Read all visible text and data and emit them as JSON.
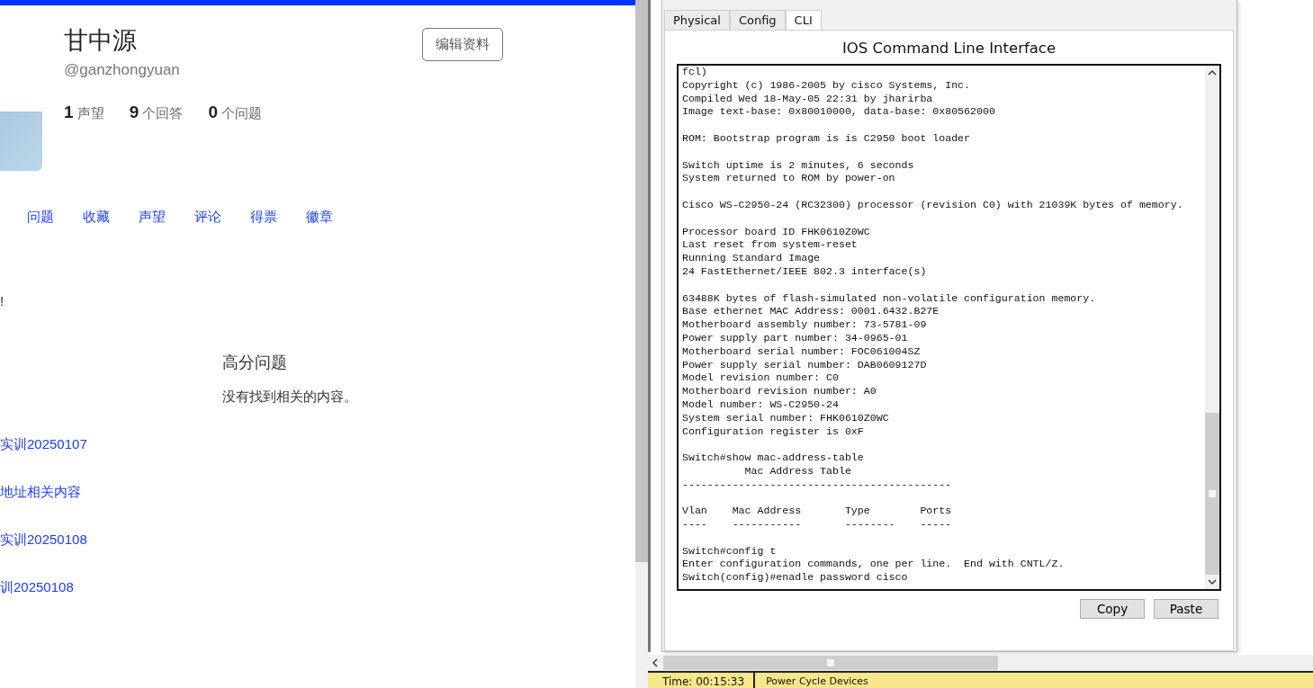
{
  "profile": {
    "name": "甘中源",
    "handle": "@ganzhongyuan",
    "edit_button": "编辑资料",
    "stats": [
      "**1** 声望",
      "**9** 个回答",
      "**0** 个问题"
    ]
  },
  "tabs": [
    "问题",
    "收藏",
    "声望",
    "评论",
    "得票",
    "徽章"
  ],
  "fragment": "!",
  "section": {
    "title": "高分问题",
    "empty_text": "没有找到相关的内容。"
  },
  "links": [
    "实训20250107",
    "地址相关内容",
    "实训20250108",
    "训20250108"
  ],
  "device": {
    "tabs": [
      {
        "label": "Physical",
        "selected": false
      },
      {
        "label": "Config",
        "selected": false
      },
      {
        "label": "CLI",
        "selected": true
      }
    ],
    "title": "IOS Command Line Interface",
    "terminal": [
      [
        "fcl)",
        "Copyright (c) 1986-2005 by cisco Systems, Inc.",
        "Compiled Wed 18-May-05 22:31 by jharirba",
        "Image text-base: 0x80010000, data-base: 0x80562000"
      ],
      [
        "ROM: Bootstrap program is is C2950 boot loader"
      ],
      [
        "Switch uptime is 2 minutes, 6 seconds",
        "System returned to ROM by power-on"
      ],
      [
        "Cisco WS-C2950-24 (RC32300) processor (revision C0) with 21039K bytes of memory."
      ],
      [
        "Processor board ID FHK0610Z0WC",
        "Last reset from system-reset",
        "Running Standard Image",
        "24 FastEthernet/IEEE 802.3 interface(s)"
      ],
      [
        "63488K bytes of flash-simulated non-volatile configuration memory.",
        "Base ethernet MAC Address: 0001.6432.B27E",
        "Motherboard assembly number: 73-5781-09",
        "Power supply part number: 34-0965-01",
        "Motherboard serial number: FOC061004SZ",
        "Power supply serial number: DAB0609127D",
        "Model revision number: C0",
        "Motherboard revision number: A0",
        "Model number: WS-C2950-24",
        "System serial number: FHK0610Z0WC",
        "Configuration register is 0xF"
      ],
      [
        "Switch#show mac-address-table",
        "          Mac Address Table",
        "-------------------------------------------"
      ],
      [
        "Vlan    Mac Address       Type        Ports",
        "----    -----------       --------    -----"
      ],
      [
        "Switch#config t",
        "Enter configuration commands, one per line.  End with CNTL/Z.",
        "Switch(config)#enadle password cisco"
      ]
    ],
    "buttons": [
      "Copy",
      "Paste"
    ]
  },
  "status_bar": {
    "time": "Time: 00:15:33",
    "action": "Power Cycle Devices"
  }
}
